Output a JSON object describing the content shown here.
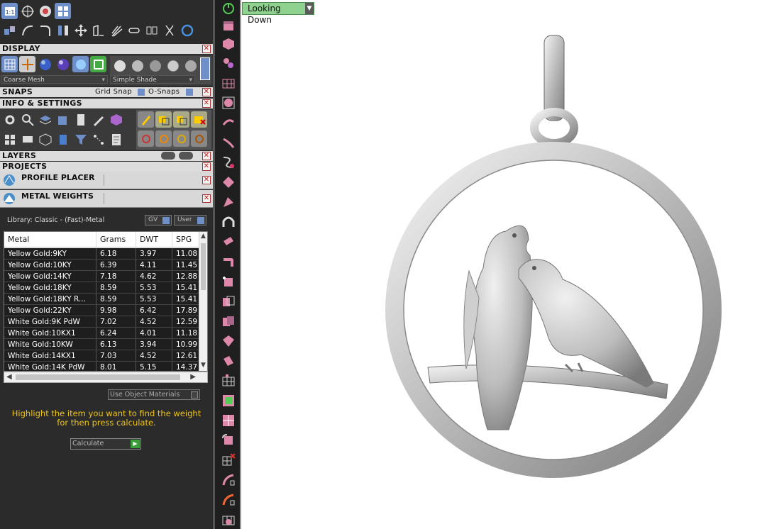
{
  "panel": {
    "display_label": "DISPLAY",
    "mesh_mode": "Coarse Mesh",
    "shade_mode": "Simple Shade",
    "snaps_label": "SNAPS",
    "grid_snap_label": "Grid Snap",
    "osnaps_label": "O-Snaps",
    "info_label": "INFO & SETTINGS",
    "layers_label": "LAYERS",
    "projects_label": "PROJECTS",
    "profile_placer_label": "PROFILE PLACER",
    "metal_weights_label": "METAL WEIGHTS",
    "close_glyph": "✕"
  },
  "weights": {
    "library_label": "Library: Classic - (Fast)-Metal",
    "gv_label": "GV",
    "user_label": "User",
    "columns": [
      "Metal",
      "Grams",
      "DWT",
      "SPG"
    ],
    "rows": [
      {
        "metal": "Yellow Gold:9KY",
        "grams": "6.18",
        "dwt": "3.97",
        "spg": "11.08"
      },
      {
        "metal": "Yellow Gold:10KY",
        "grams": "6.39",
        "dwt": "4.11",
        "spg": "11.45"
      },
      {
        "metal": "Yellow Gold:14KY",
        "grams": "7.18",
        "dwt": "4.62",
        "spg": "12.88"
      },
      {
        "metal": "Yellow Gold:18KY",
        "grams": "8.59",
        "dwt": "5.53",
        "spg": "15.41"
      },
      {
        "metal": "Yellow Gold:18KY R...",
        "grams": "8.59",
        "dwt": "5.53",
        "spg": "15.41"
      },
      {
        "metal": "Yellow Gold:22KY",
        "grams": "9.98",
        "dwt": "6.42",
        "spg": "17.89"
      },
      {
        "metal": "White Gold:9K PdW",
        "grams": "7.02",
        "dwt": "4.52",
        "spg": "12.59"
      },
      {
        "metal": "White Gold:10KX1",
        "grams": "6.24",
        "dwt": "4.01",
        "spg": "11.18"
      },
      {
        "metal": "White Gold:10KW",
        "grams": "6.13",
        "dwt": "3.94",
        "spg": "10.99"
      },
      {
        "metal": "White Gold:14KX1",
        "grams": "7.03",
        "dwt": "4.52",
        "spg": "12.61"
      },
      {
        "metal": "White Gold:14K PdW",
        "grams": "8.01",
        "dwt": "5.15",
        "spg": "14.37"
      }
    ],
    "use_object_materials": "Use Object Materials",
    "instruction": "Highlight the item you want to find the weight for then press calculate.",
    "calculate_label": "Calculate"
  },
  "viewport": {
    "view_name": "Looking Down"
  },
  "colors": {
    "accent_yellow": "#f0c419",
    "view_label_bg": "#8fd18f",
    "panel_bg": "#2b2b2b"
  }
}
